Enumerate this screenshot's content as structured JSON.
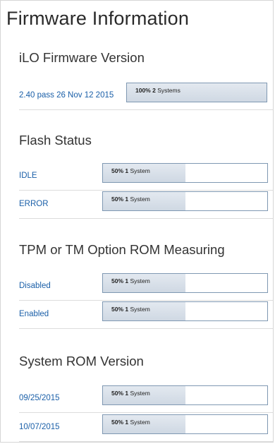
{
  "title": "Firmware Information",
  "sections": [
    {
      "title": "iLO Firmware Version",
      "rows": [
        {
          "label": "2.40 pass 26 Nov 12 2015",
          "percent": "100%",
          "count": "2",
          "unit": "Systems",
          "fill": 1.0
        }
      ]
    },
    {
      "title": "Flash Status",
      "rows": [
        {
          "label": "IDLE",
          "percent": "50%",
          "count": "1",
          "unit": "System",
          "fill": 0.5
        },
        {
          "label": "ERROR",
          "percent": "50%",
          "count": "1",
          "unit": "System",
          "fill": 0.5
        }
      ]
    },
    {
      "title": "TPM or TM Option ROM Measuring",
      "rows": [
        {
          "label": "Disabled",
          "percent": "50%",
          "count": "1",
          "unit": "System",
          "fill": 0.5
        },
        {
          "label": "Enabled",
          "percent": "50%",
          "count": "1",
          "unit": "System",
          "fill": 0.5
        }
      ]
    },
    {
      "title": "System ROM Version",
      "rows": [
        {
          "label": "09/25/2015",
          "percent": "50%",
          "count": "1",
          "unit": "System",
          "fill": 0.5
        },
        {
          "label": "10/07/2015",
          "percent": "50%",
          "count": "1",
          "unit": "System",
          "fill": 0.5
        }
      ]
    }
  ]
}
